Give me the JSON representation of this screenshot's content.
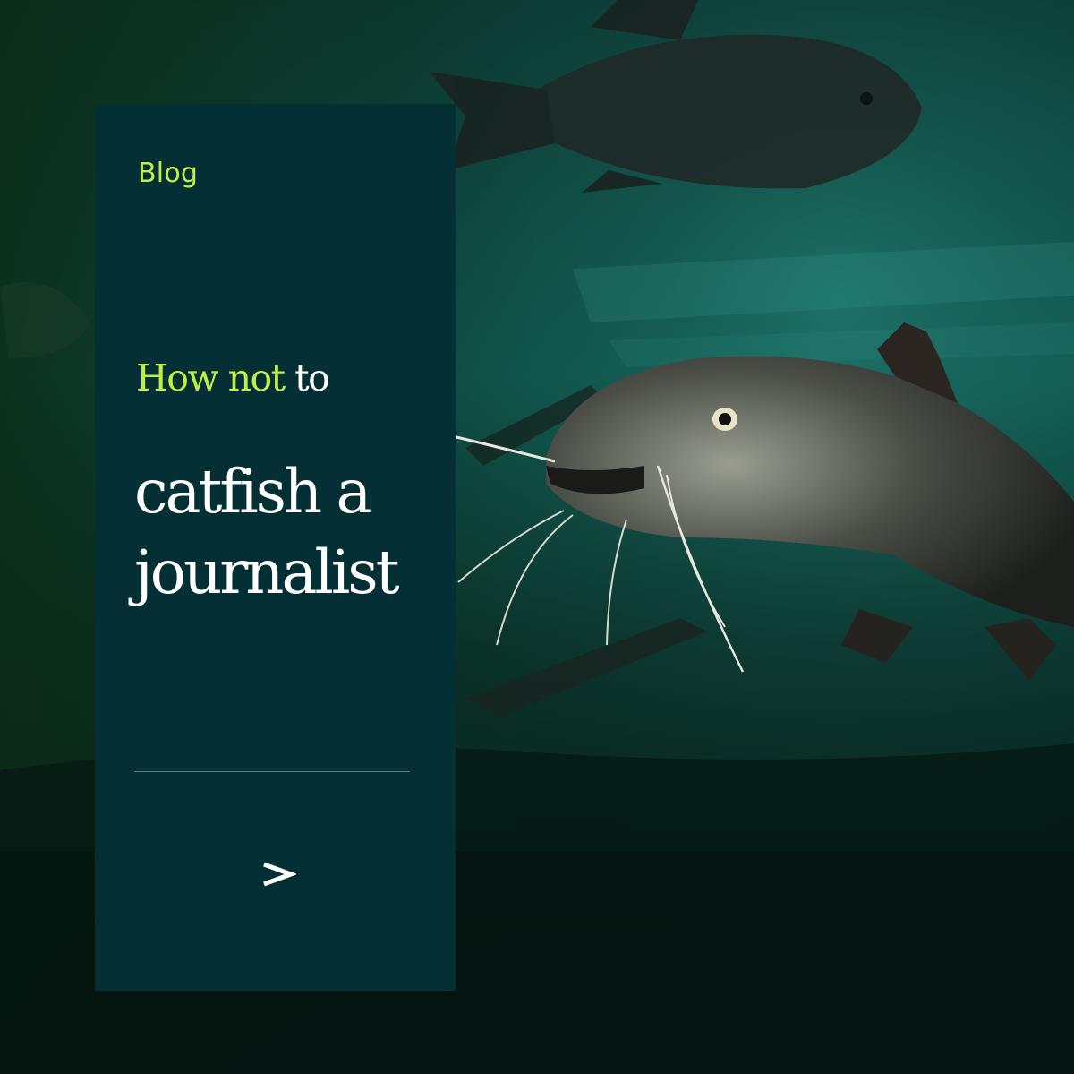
{
  "card": {
    "tag": "Blog",
    "kicker_accent": "How not",
    "kicker_rest": " to",
    "headline": "catfish a journalist",
    "next_label": ">"
  },
  "colors": {
    "card_background": "#032f35",
    "accent": "#c1f044",
    "text": "#ffffff",
    "water": "#0d4a44"
  },
  "icons": {
    "next": "chevron-right-icon"
  },
  "image": {
    "subject": "underwater photo of catfish"
  }
}
